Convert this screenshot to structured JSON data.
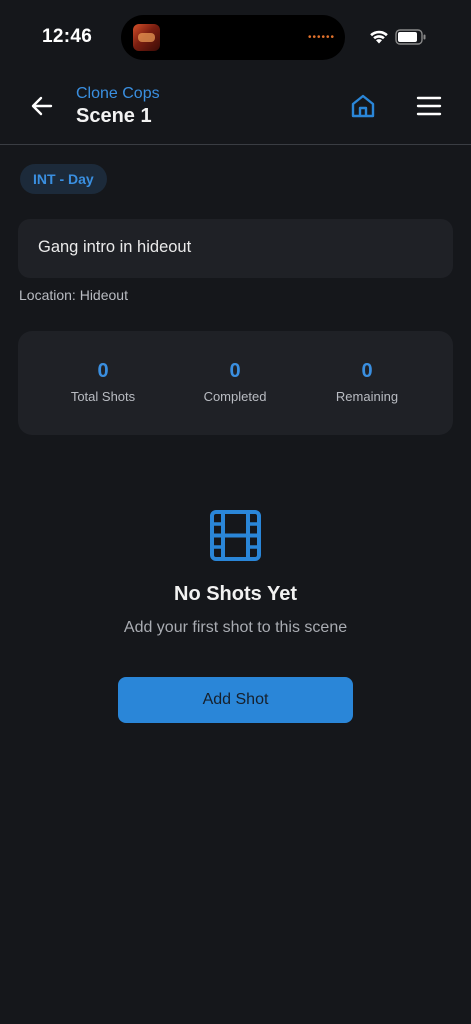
{
  "status_bar": {
    "time": "12:46",
    "icons": [
      "now-playing-thumbnail",
      "activity-dots",
      "wifi-icon",
      "battery-icon"
    ]
  },
  "header": {
    "project": "Clone Cops",
    "scene": "Scene 1",
    "icons": [
      "back-arrow-icon",
      "home-icon",
      "menu-icon"
    ]
  },
  "scene": {
    "badge": "INT - Day",
    "description": "Gang intro in hideout",
    "location": "Location: Hideout"
  },
  "stats": [
    {
      "value": "0",
      "label": "Total Shots"
    },
    {
      "value": "0",
      "label": "Completed"
    },
    {
      "value": "0",
      "label": "Remaining"
    }
  ],
  "empty_state": {
    "icon": "film-icon",
    "title": "No Shots Yet",
    "subtitle": "Add your first shot to this scene",
    "button": "Add Shot"
  },
  "colors": {
    "background": "#15171b",
    "card": "#1f2126",
    "accent": "#2a86d8",
    "accent_text": "#3a8fe0"
  }
}
